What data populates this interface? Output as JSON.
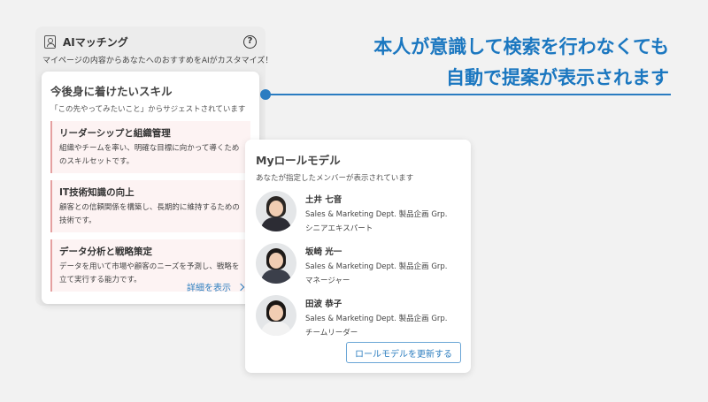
{
  "ai_panel": {
    "title": "AIマッチング",
    "subtitle": "マイページの内容からあなたへのおすすめをAIがカスタマイズ！",
    "help_symbol": "?",
    "icon": "profile-card-icon"
  },
  "skills": {
    "title": "今後身に着けたいスキル",
    "subtitle": "「この先やってみたいこと」からサジェストされています",
    "items": [
      {
        "title": "リーダーシップと組織管理",
        "desc": "組織やチームを率い、明確な目標に向かって導くためのスキルセットです。"
      },
      {
        "title": "IT技術知識の向上",
        "desc": "顧客との信頼関係を構築し、長期的に維持するための技術です。"
      },
      {
        "title": "データ分析と戦略策定",
        "desc": "データを用いて市場や顧客のニーズを予測し、戦略を立て実行する能力です。"
      }
    ],
    "detail_link": "詳細を表示"
  },
  "role_models": {
    "title": "Myロールモデル",
    "subtitle": "あなたが指定したメンバーが表示されています",
    "people": [
      {
        "name": "土井 七音",
        "dept": "Sales & Marketing Dept.  製品企画 Grp.",
        "role": "シニアエキスパート",
        "hair": "#2b2623",
        "clothes": "#2c2c34"
      },
      {
        "name": "坂崎 光一",
        "dept": "Sales & Marketing Dept.  製品企画 Grp.",
        "role": "マネージャー",
        "hair": "#1e1a18",
        "clothes": "#3b3f4a"
      },
      {
        "name": "田波 恭子",
        "dept": "Sales & Marketing Dept.  製品企画 Grp.",
        "role": "チームリーダー",
        "hair": "#1a1614",
        "clothes": "#f2f2f2"
      }
    ],
    "update_button": "ロールモデルを更新する"
  },
  "headline": {
    "line1": "本人が意識して検索を行わなくても",
    "line2": "自動で提案が表示されます"
  },
  "colors": {
    "accent": "#2a7cc1",
    "skill_bg": "#fdf3f3",
    "skill_border": "#e5a0a0"
  }
}
